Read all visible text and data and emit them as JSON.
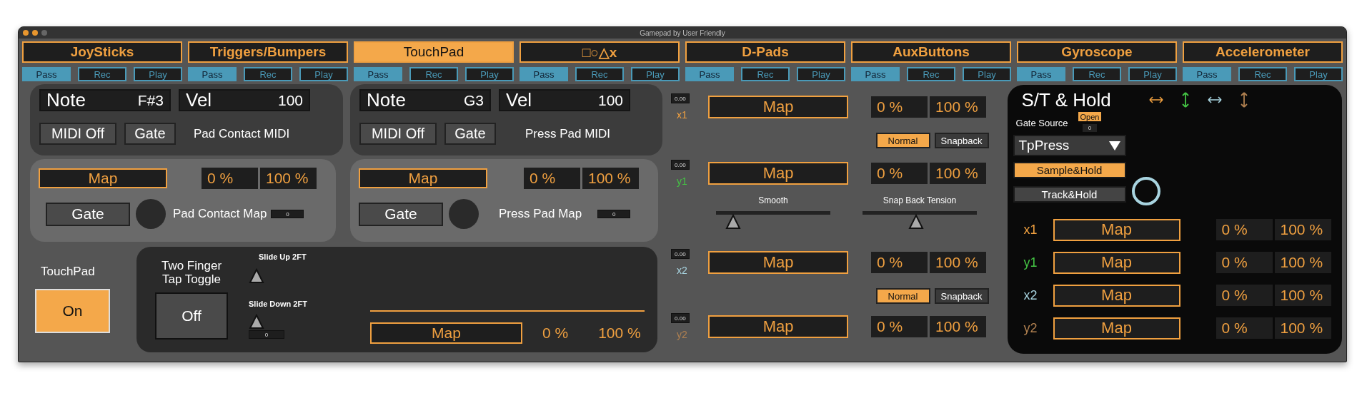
{
  "window": {
    "title": "Gamepad by User Friendly"
  },
  "tabs": [
    {
      "label": "JoySticks",
      "selected": false,
      "modes": [
        {
          "label": "Pass",
          "selected": true
        },
        {
          "label": "Rec",
          "selected": false
        },
        {
          "label": "Play",
          "selected": false
        }
      ]
    },
    {
      "label": "Triggers/Bumpers",
      "selected": false,
      "modes": [
        {
          "label": "Pass",
          "selected": true
        },
        {
          "label": "Rec",
          "selected": false
        },
        {
          "label": "Play",
          "selected": false
        }
      ]
    },
    {
      "label": "TouchPad",
      "selected": true,
      "modes": [
        {
          "label": "Pass",
          "selected": true
        },
        {
          "label": "Rec",
          "selected": false
        },
        {
          "label": "Play",
          "selected": false
        }
      ]
    },
    {
      "label": "□○△x",
      "selected": false,
      "modes": [
        {
          "label": "Pass",
          "selected": true
        },
        {
          "label": "Rec",
          "selected": false
        },
        {
          "label": "Play",
          "selected": false
        }
      ]
    },
    {
      "label": "D-Pads",
      "selected": false,
      "modes": [
        {
          "label": "Pass",
          "selected": true
        },
        {
          "label": "Rec",
          "selected": false
        },
        {
          "label": "Play",
          "selected": false
        }
      ]
    },
    {
      "label": "AuxButtons",
      "selected": false,
      "modes": [
        {
          "label": "Pass",
          "selected": true
        },
        {
          "label": "Rec",
          "selected": false
        },
        {
          "label": "Play",
          "selected": false
        }
      ]
    },
    {
      "label": "Gyroscope",
      "selected": false,
      "modes": [
        {
          "label": "Pass",
          "selected": true
        },
        {
          "label": "Rec",
          "selected": false
        },
        {
          "label": "Play",
          "selected": false
        }
      ]
    },
    {
      "label": "Accelerometer",
      "selected": false,
      "modes": [
        {
          "label": "Pass",
          "selected": true
        },
        {
          "label": "Rec",
          "selected": false
        },
        {
          "label": "Play",
          "selected": false
        }
      ]
    }
  ],
  "midi_panels": [
    {
      "note_label": "Note",
      "note": "F#3",
      "vel_label": "Vel",
      "vel": "100",
      "midi_off": "MIDI Off",
      "gate": "Gate",
      "caption": "Pad Contact MIDI"
    },
    {
      "note_label": "Note",
      "note": "G3",
      "vel_label": "Vel",
      "vel": "100",
      "midi_off": "MIDI Off",
      "gate": "Gate",
      "caption": "Press Pad MIDI"
    }
  ],
  "map_panels": [
    {
      "map": "Map",
      "min": "0 %",
      "max": "100 %",
      "gate": "Gate",
      "caption": "Pad Contact Map",
      "value": "0"
    },
    {
      "map": "Map",
      "min": "0 %",
      "max": "100 %",
      "gate": "Gate",
      "caption": "Press Pad Map",
      "value": "0"
    }
  ],
  "touchpad": {
    "label": "TouchPad",
    "button": "On",
    "on": true
  },
  "two_finger": {
    "label": "Two Finger Tap Toggle",
    "button": "Off",
    "on": false,
    "slide_up": "Slide Up 2FT",
    "slide_down": "Slide Down 2FT",
    "value": "0",
    "map": "Map",
    "min": "0 %",
    "max": "100 %"
  },
  "axes": [
    {
      "label": "x1",
      "value": "0.00",
      "color": "#f0a040",
      "map": "Map",
      "min": "0 %",
      "max": "100 %",
      "modes": [
        {
          "label": "Normal",
          "selected": true
        },
        {
          "label": "Snapback",
          "selected": false
        }
      ]
    },
    {
      "label": "y1",
      "value": "0.00",
      "color": "#44c444",
      "map": "Map",
      "min": "0 %",
      "max": "100 %"
    },
    {
      "label": "x2",
      "value": "0.00",
      "color": "#a8d4e0",
      "map": "Map",
      "min": "0 %",
      "max": "100 %",
      "modes": [
        {
          "label": "Normal",
          "selected": true
        },
        {
          "label": "Snapback",
          "selected": false
        }
      ]
    },
    {
      "label": "y2",
      "value": "0.00",
      "color": "#b08050",
      "map": "Map",
      "min": "0 %",
      "max": "100 %"
    }
  ],
  "sliders": [
    {
      "label": "Smooth",
      "level": 0.15
    },
    {
      "label": "Snap Back Tension",
      "level": 0.47
    }
  ],
  "hold": {
    "title": "S/T & Hold",
    "arrows": [
      {
        "kind": "horizontal",
        "color": "#f0a040"
      },
      {
        "kind": "vertical",
        "color": "#44c444"
      },
      {
        "kind": "horizontal",
        "color": "#a8d4e0"
      },
      {
        "kind": "vertical",
        "color": "#b08050"
      }
    ],
    "gate_label": "Gate Source",
    "open": "Open",
    "gate_value": "0",
    "source": "TpPress",
    "options": [
      {
        "label": "Sample&Hold",
        "selected": true
      },
      {
        "label": "Track&Hold",
        "selected": false
      }
    ],
    "rows": [
      {
        "label": "x1",
        "color": "#f0a040",
        "map": "Map",
        "min": "0 %",
        "max": "100 %"
      },
      {
        "label": "y1",
        "color": "#44c444",
        "map": "Map",
        "min": "0 %",
        "max": "100 %"
      },
      {
        "label": "x2",
        "color": "#a8d4e0",
        "map": "Map",
        "min": "0 %",
        "max": "100 %"
      },
      {
        "label": "y2",
        "color": "#b08050",
        "map": "Map",
        "min": "0 %",
        "max": "100 %"
      }
    ]
  }
}
